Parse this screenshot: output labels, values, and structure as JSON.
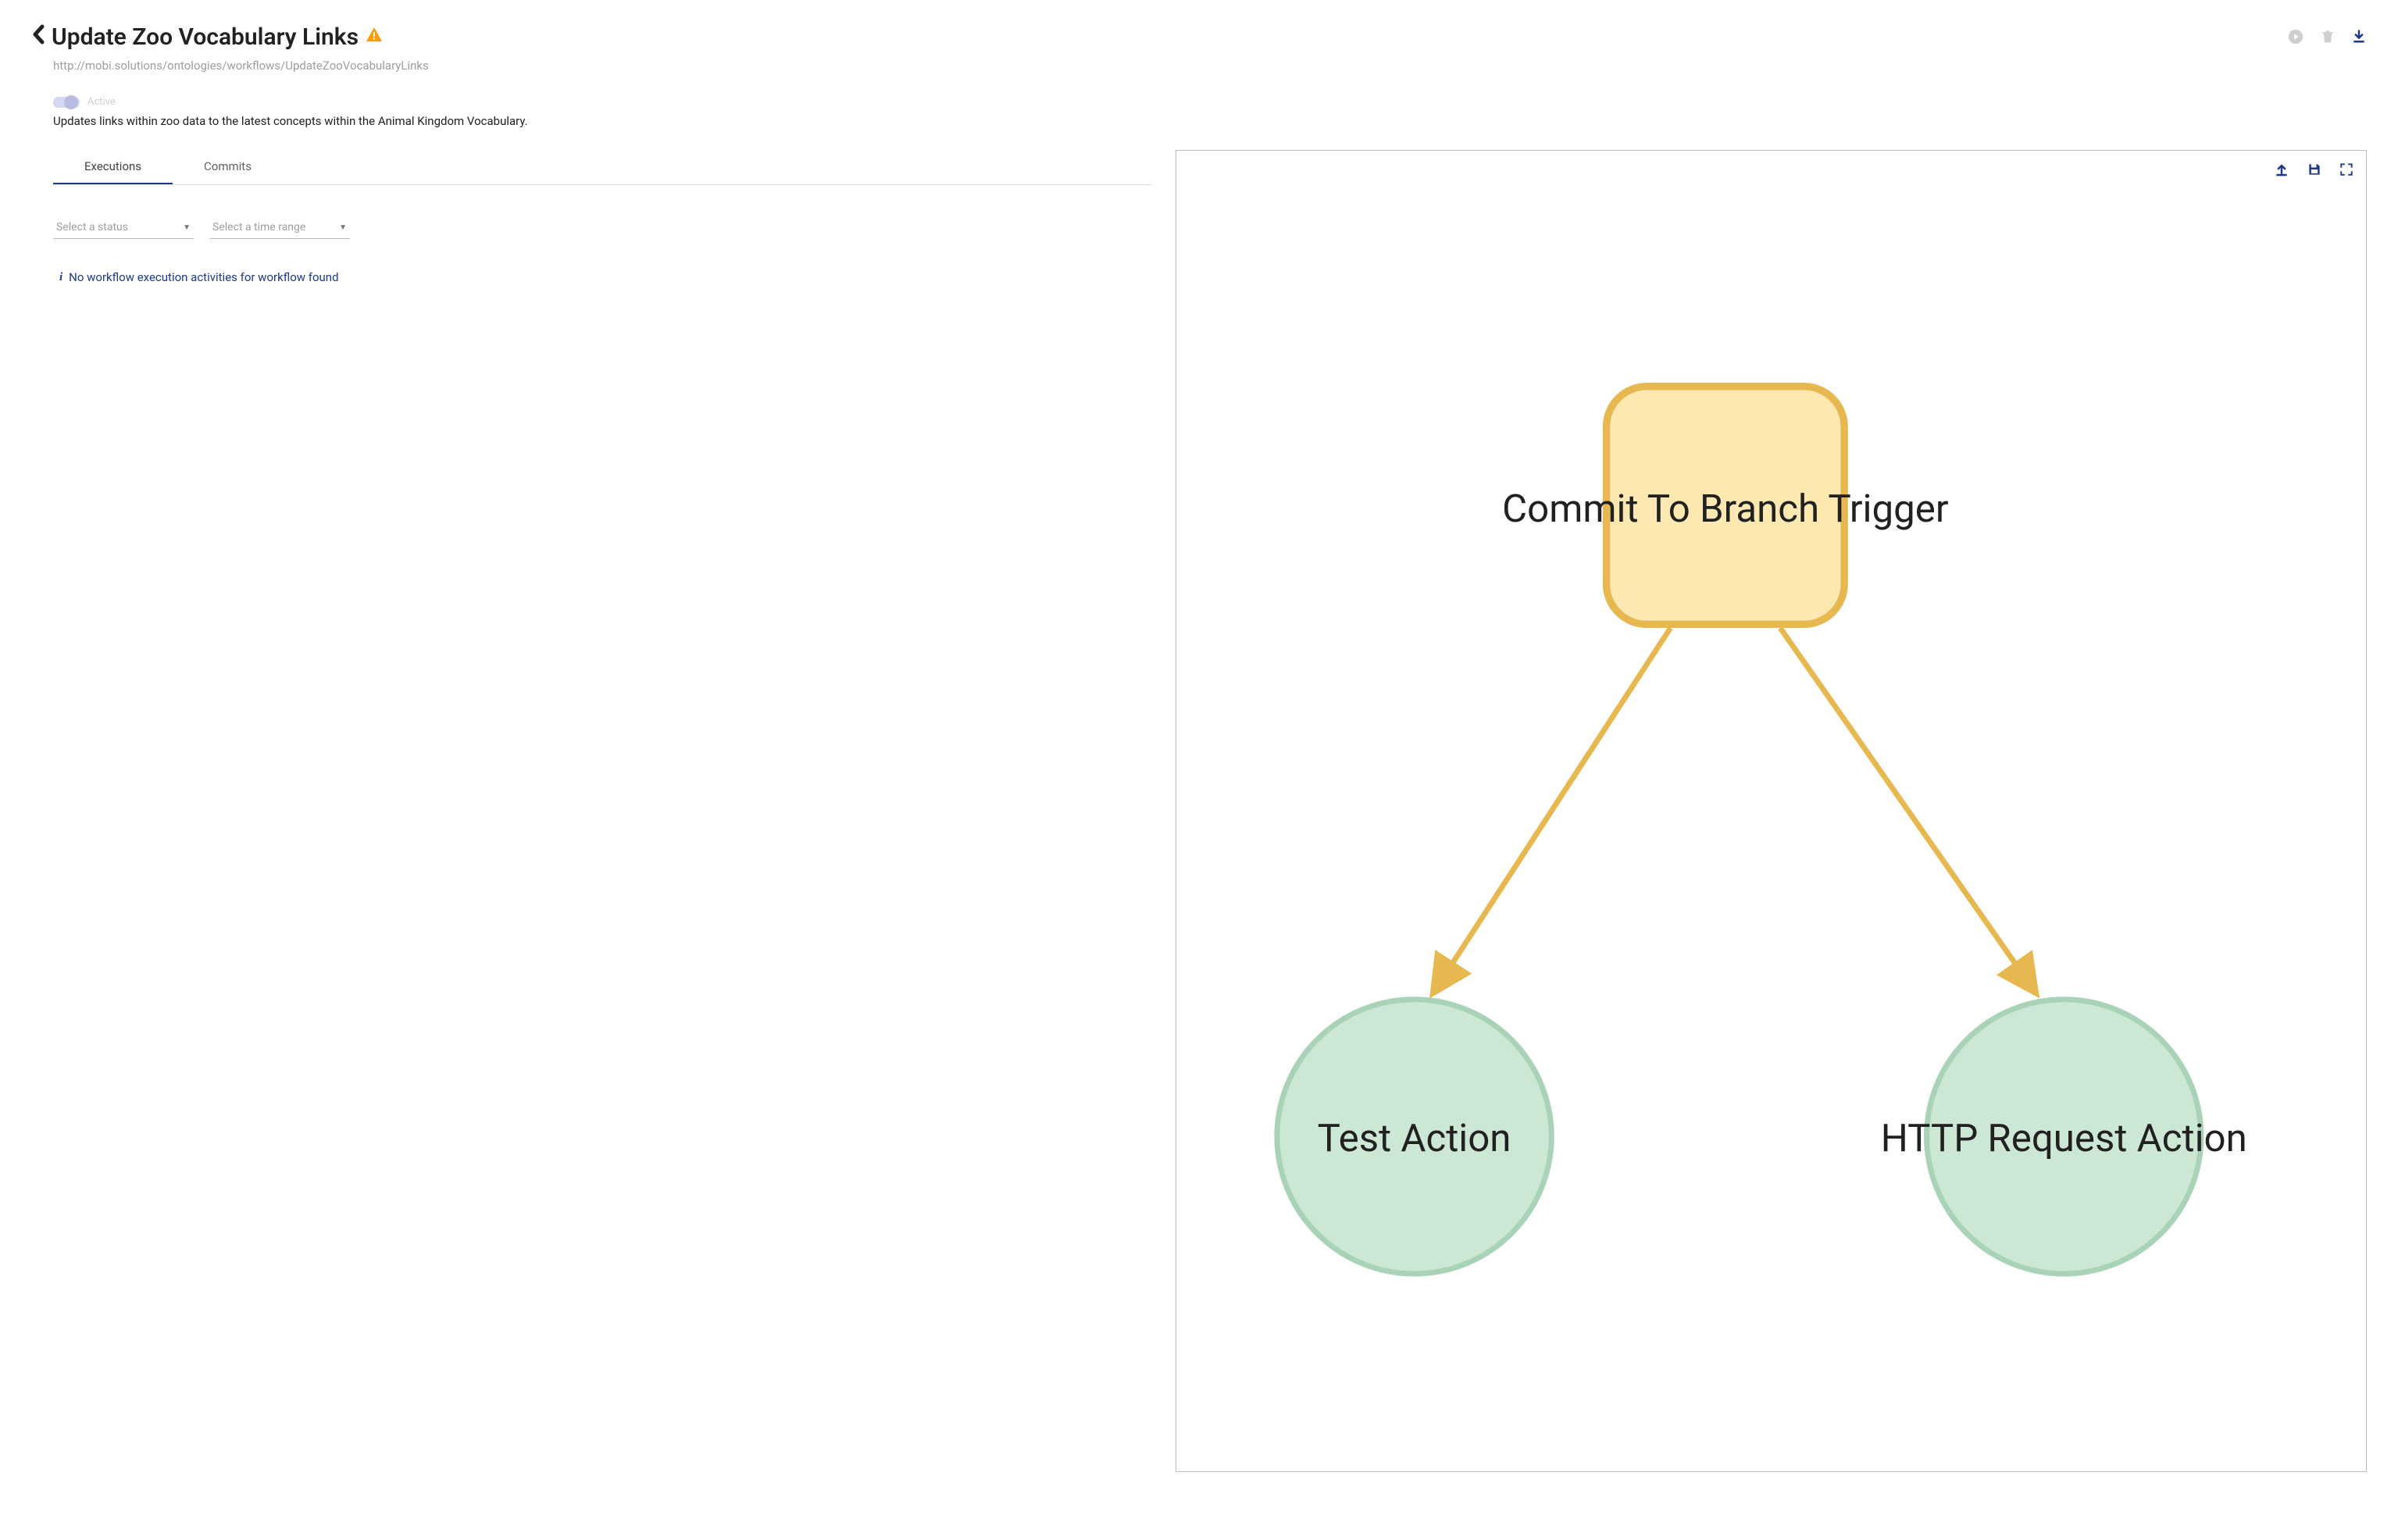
{
  "header": {
    "title": "Update Zoo Vocabulary Links",
    "url": "http://mobi.solutions/ontologies/workflows/UpdateZooVocabularyLinks",
    "active_label": "Active",
    "description": "Updates links within zoo data to the latest concepts within the Animal Kingdom Vocabulary."
  },
  "tabs": {
    "executions": "Executions",
    "commits": "Commits"
  },
  "filters": {
    "status_placeholder": "Select a status",
    "timerange_placeholder": "Select a time range"
  },
  "empty_msg": "No workflow execution activities for workflow found",
  "diagram": {
    "trigger_label": "Commit To Branch Trigger",
    "action1_label": "Test Action",
    "action2_label": "HTTP Request Action"
  }
}
